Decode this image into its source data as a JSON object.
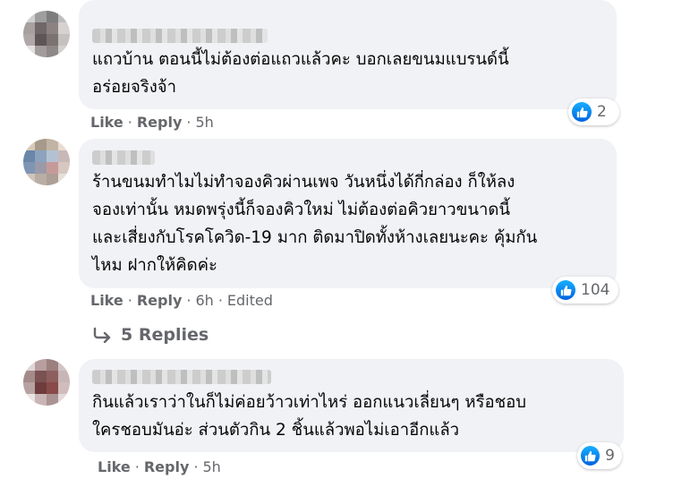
{
  "comments": [
    {
      "text": "แถวบ้าน ตอนนี้ไม่ต้องต่อแถวแล้วคะ บอกเลยขนมแบรนด์นี้\nอร่อยจริงจ้า",
      "like_label": "Like",
      "reply_label": "Reply",
      "time": "5h",
      "reaction_count": "2",
      "avatar_colors": [
        "#cfcfcf",
        "#9e9e9e",
        "#7d7d7d",
        "#bdbdbd",
        "#a8a0a0",
        "#6e6868",
        "#8c8282",
        "#d7d2d2",
        "#b0a8a8",
        "#5c5656",
        "#7b7272",
        "#c6c0c0",
        "#e3e0e0",
        "#a39c9c",
        "#8e8888",
        "#d4d0d0"
      ]
    },
    {
      "text": "ร้านขนมทำไมไม่ทำจองคิวผ่านเพจ วันหนึ่งได้กี่กล่อง ก็ให้ลง\nจองเท่านั้น หมดพรุ่งนี้ก็จองคิวใหม่ ไม่ต้องต่อคิวยาวขนาดนี้\nและเสี่ยงกับโรคโควิด-19 มาก ติดมาปิดทั้งห้างเลยนะคะ คุ้มกัน\nไหม ฝากให้คิดค่ะ",
      "like_label": "Like",
      "reply_label": "Reply",
      "time": "6h",
      "edited_label": "Edited",
      "reaction_count": "104",
      "avatar_colors": [
        "#d8c9b8",
        "#a79a8a",
        "#c2b4a4",
        "#e8ddd0",
        "#6a86a8",
        "#8da3bd",
        "#b3c2d3",
        "#c9b8b8",
        "#7e96b3",
        "#9a9aa8",
        "#c79a9a",
        "#d6c7c0",
        "#cfc4bb",
        "#b9aea4",
        "#ad9f96",
        "#e6e0da"
      ]
    },
    {
      "text": "กินแล้วเราว่าในก็ไม่ค่อยว้าวเท่าไหร่ ออกแนวเลี่ยนๆ หรือชอบ\nใครชอบมันอ่ะ ส่วนตัวกิน 2 ชิ้นแล้วพอไม่เอาอีกแล้ว",
      "like_label": "Like",
      "reply_label": "Reply",
      "time": "5h",
      "reaction_count": "9",
      "avatar_colors": [
        "#e0d6d6",
        "#b89e9e",
        "#9c7f7f",
        "#d3c4c4",
        "#a58a8a",
        "#7a5252",
        "#8e5e5e",
        "#c8b6b6",
        "#b7a2a2",
        "#6e3c3c",
        "#8a4a4a",
        "#d1bcbc",
        "#ece4e4",
        "#c9b5b5",
        "#a99393",
        "#e4dada"
      ]
    }
  ],
  "replies_label": "5 Replies"
}
